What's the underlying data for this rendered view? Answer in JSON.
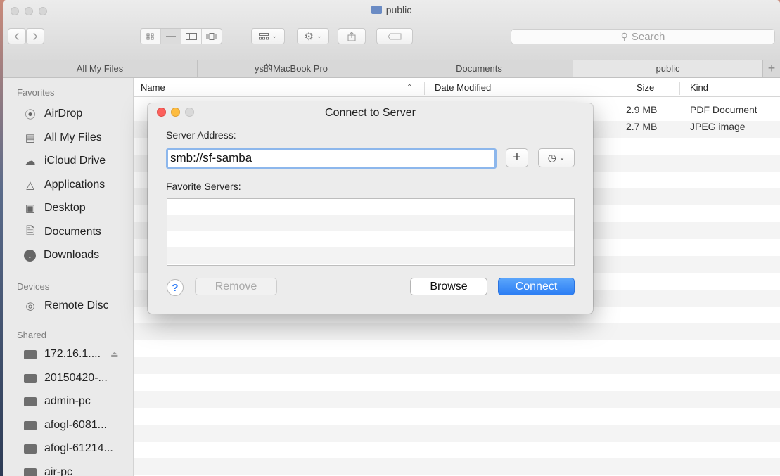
{
  "window": {
    "title": "public"
  },
  "toolbar": {
    "search_placeholder": "Search"
  },
  "tabs": [
    "All My Files",
    "ys的MacBook Pro",
    "Documents",
    "public"
  ],
  "tab_plus": "+",
  "sidebar": {
    "favorites_header": "Favorites",
    "favorites": [
      {
        "label": "AirDrop",
        "icon": "airdrop-icon"
      },
      {
        "label": "All My Files",
        "icon": "all-files-icon"
      },
      {
        "label": "iCloud Drive",
        "icon": "cloud-icon"
      },
      {
        "label": "Applications",
        "icon": "applications-icon"
      },
      {
        "label": "Desktop",
        "icon": "desktop-icon"
      },
      {
        "label": "Documents",
        "icon": "documents-icon"
      },
      {
        "label": "Downloads",
        "icon": "downloads-icon"
      }
    ],
    "devices_header": "Devices",
    "devices": [
      {
        "label": "Remote Disc",
        "icon": "disc-icon"
      }
    ],
    "shared_header": "Shared",
    "shared": [
      {
        "label": "172.16.1....",
        "eject": "⏏"
      },
      {
        "label": "20150420-..."
      },
      {
        "label": "admin-pc"
      },
      {
        "label": "afogl-6081..."
      },
      {
        "label": "afogl-61214..."
      },
      {
        "label": "air-pc"
      }
    ]
  },
  "columns": {
    "name": "Name",
    "date": "Date Modified",
    "size": "Size",
    "kind": "Kind"
  },
  "files": [
    {
      "size": "2.9 MB",
      "kind": "PDF Document"
    },
    {
      "size": "2.7 MB",
      "kind": "JPEG image"
    }
  ],
  "dialog": {
    "title": "Connect to Server",
    "server_address_label": "Server Address:",
    "server_address_value": "smb://sf-samba",
    "favorite_servers_label": "Favorite Servers:",
    "help": "?",
    "remove": "Remove",
    "browse": "Browse",
    "connect": "Connect",
    "add": "+"
  }
}
